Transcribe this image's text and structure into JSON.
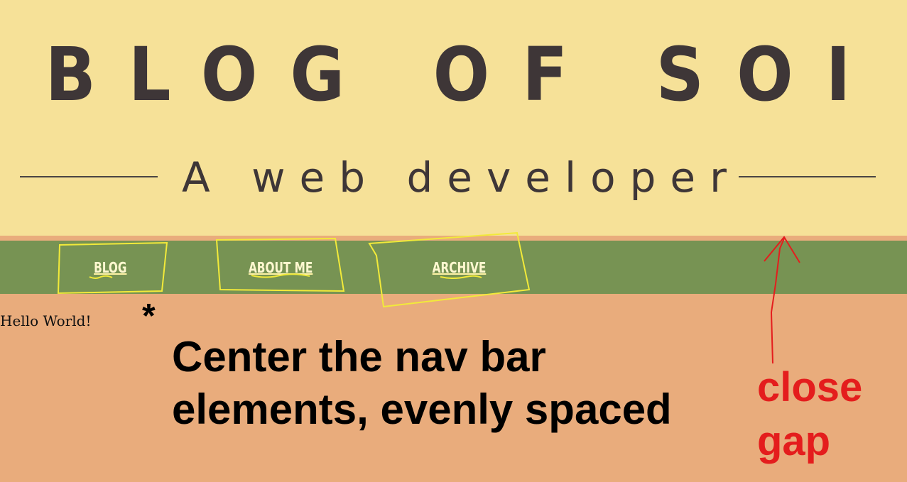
{
  "header": {
    "title": "BLOG OF SOI",
    "subtitle": "A web developer"
  },
  "nav": {
    "items": [
      {
        "label": "BLOG"
      },
      {
        "label": "ABOUT ME"
      },
      {
        "label": "ARCHIVE"
      }
    ]
  },
  "content": {
    "hello": "Hello World!"
  },
  "annotations": {
    "asterisk": "*",
    "instruction_line1": "Center the nav bar",
    "instruction_line2": "elements, evenly spaced",
    "gap_line1": "close",
    "gap_line2": "gap",
    "scribble_color": "#f2ea3a",
    "arrow_color": "#e41d1d"
  },
  "colors": {
    "header_bg": "#f6e198",
    "nav_bg": "#779353",
    "page_bg": "#e9ac7c",
    "title_text": "#3e3637"
  }
}
